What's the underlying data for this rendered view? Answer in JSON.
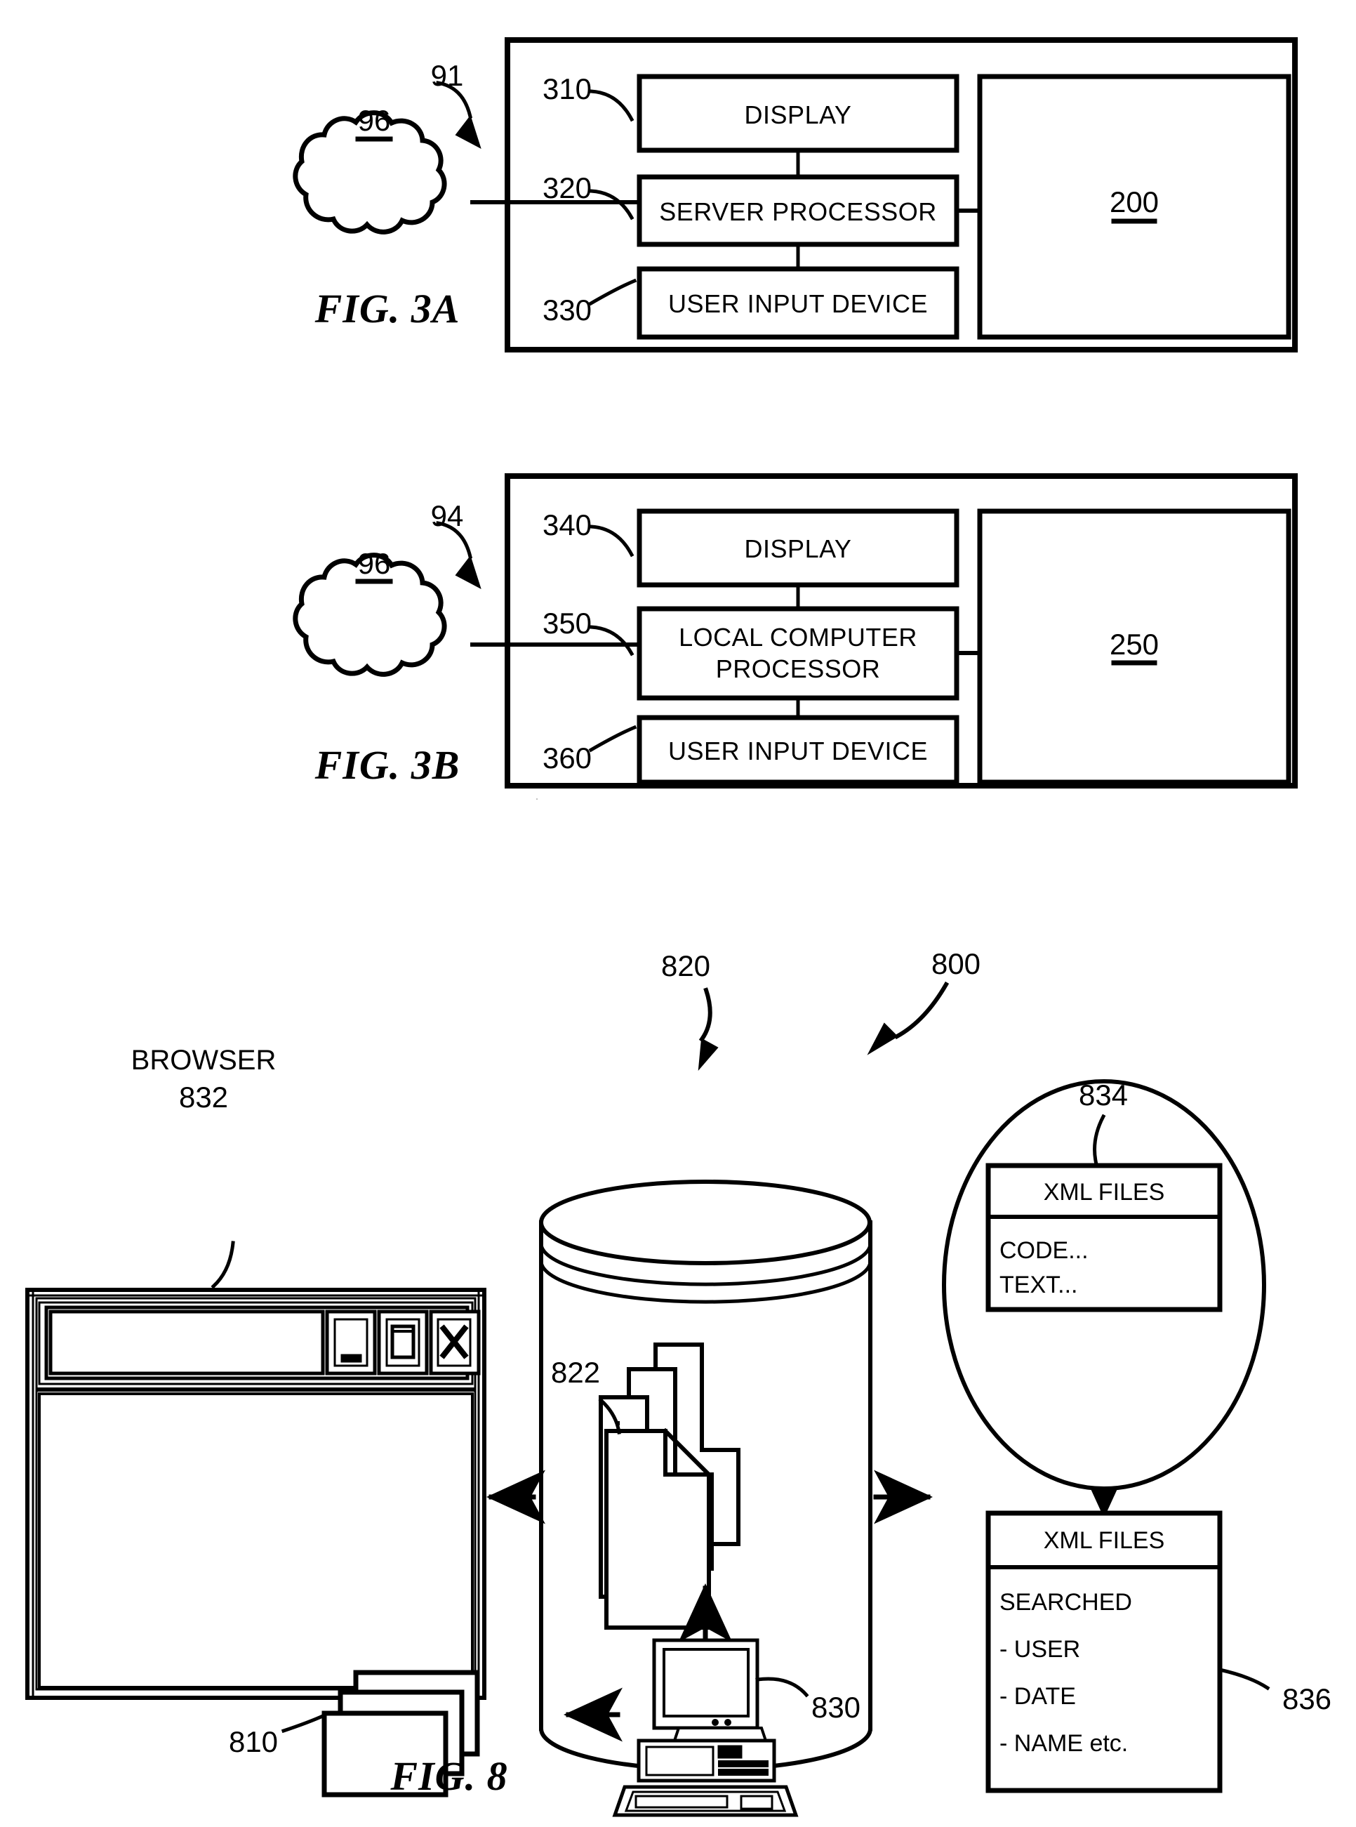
{
  "figures": [
    {
      "id": "fig-3a",
      "caption": "FIG. 3A",
      "system_ref": "91",
      "cloud_ref": "96",
      "memory_ref": "200",
      "blocks": [
        {
          "ref": "310",
          "label": "DISPLAY"
        },
        {
          "ref": "320",
          "label": "SERVER PROCESSOR"
        },
        {
          "ref": "330",
          "label": "USER INPUT DEVICE"
        }
      ]
    },
    {
      "id": "fig-3b",
      "caption": "FIG. 3B",
      "system_ref": "94",
      "cloud_ref": "96",
      "memory_ref": "250",
      "blocks": [
        {
          "ref": "340",
          "label": "DISPLAY"
        },
        {
          "ref": "350",
          "label": "LOCAL COMPUTER PROCESSOR",
          "label_line1": "LOCAL COMPUTER",
          "label_line2": "PROCESSOR"
        },
        {
          "ref": "360",
          "label": "USER INPUT DEVICE"
        }
      ]
    },
    {
      "id": "fig-8",
      "caption": "FIG. 8",
      "system_ref": "800",
      "browser": {
        "title": "BROWSER",
        "ref": "832",
        "buttons": [
          "minimize",
          "maximize",
          "close"
        ]
      },
      "database": {
        "ref": "820",
        "documents_ref": "822"
      },
      "computer": {
        "ref": "830"
      },
      "documents": {
        "ref": "810"
      },
      "circle_panel": {
        "ref": "834",
        "header": "XML FILES",
        "lines": [
          "CODE...",
          "TEXT..."
        ]
      },
      "result_panel": {
        "ref": "836",
        "header": "XML FILES",
        "lines": [
          "SEARCHED",
          "- USER",
          "- DATE",
          "- NAME etc."
        ]
      }
    }
  ],
  "colors": {
    "ink": "#000000",
    "paper": "#ffffff"
  }
}
